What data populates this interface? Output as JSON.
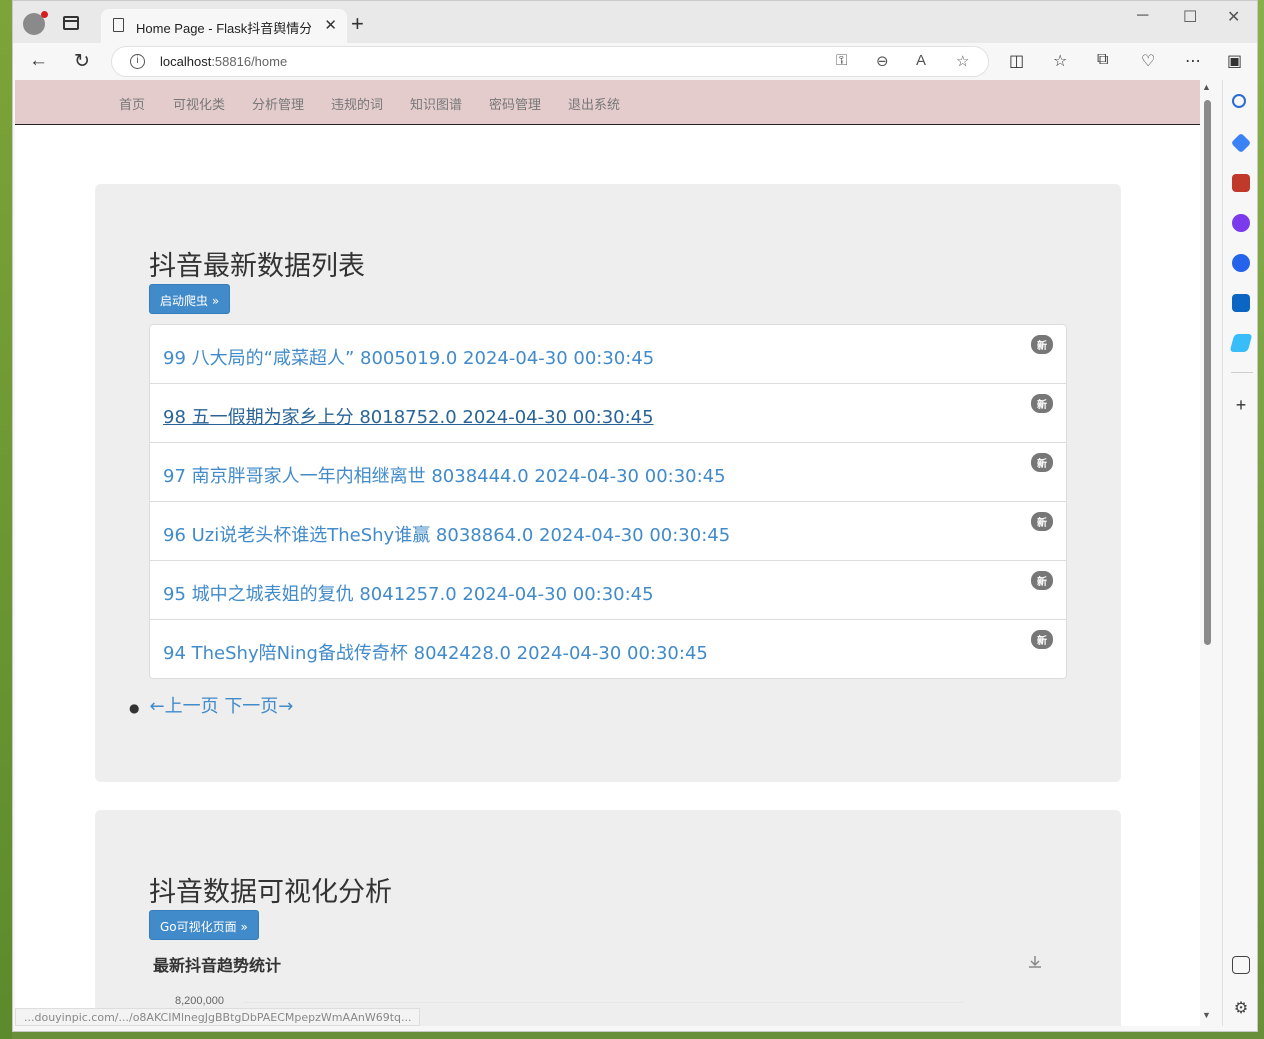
{
  "browser": {
    "tab_title": "Home Page - Flask抖音舆情分析",
    "tab_close": "✕",
    "new_tab": "+",
    "url_host": "localhost",
    "url_path": ":58816/home",
    "status_url": "...douyinpic.com/.../o8AKCIMlnegJgBBtgDbPAECMpepzWmAAnW69tq..."
  },
  "site_nav": {
    "items": [
      "首页",
      "可视化类",
      "分析管理",
      "违规的词",
      "知识图谱",
      "密码管理",
      "退出系统"
    ]
  },
  "section1": {
    "title": "抖音最新数据列表",
    "button": "启动爬虫 »",
    "badge": "新",
    "items": [
      "99 八大局的“咸菜超人” 8005019.0 2024-04-30 00:30:45",
      "98 五一假期为家乡上分 8018752.0 2024-04-30 00:30:45",
      "97 南京胖哥家人一年内相继离世 8038444.0 2024-04-30 00:30:45",
      "96 Uzi说老头杯谁选TheShy谁赢 8038864.0 2024-04-30 00:30:45",
      "95 城中之城表姐的复仇 8041257.0 2024-04-30 00:30:45",
      "94 TheShy陪Ning备战传奇杯 8042428.0 2024-04-30 00:30:45"
    ],
    "pager_prev": "←上一页",
    "pager_next": "下一页→"
  },
  "section2": {
    "title": "抖音数据可视化分析",
    "button": "Go可视化页面 »",
    "chart_title": "最新抖音趋势统计"
  },
  "chart_data": {
    "type": "line",
    "title": "最新抖音趋势统计",
    "y_ticks": [
      "8,200,000"
    ],
    "series": [
      {
        "values": []
      }
    ]
  }
}
